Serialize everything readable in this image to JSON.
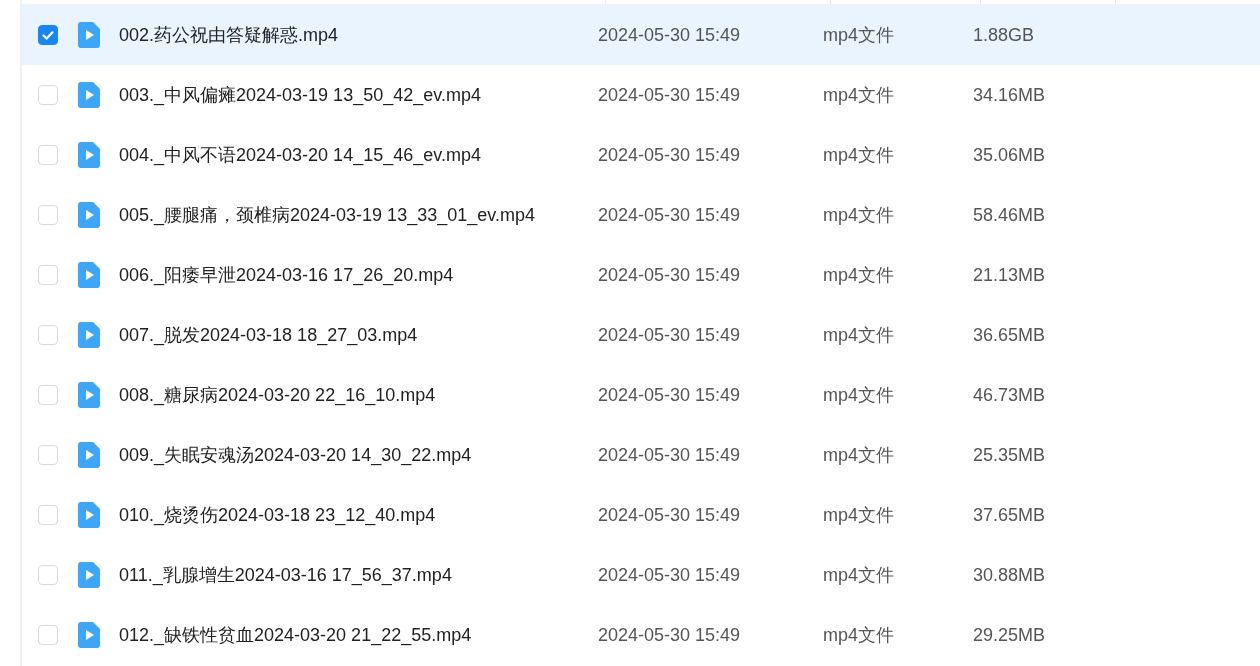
{
  "files": [
    {
      "name": "002.药公祝由答疑解惑.mp4",
      "modified": "2024-05-30 15:49",
      "type": "mp4文件",
      "size": "1.88GB",
      "selected": true
    },
    {
      "name": "003._中风偏瘫2024-03-19 13_50_42_ev.mp4",
      "modified": "2024-05-30 15:49",
      "type": "mp4文件",
      "size": "34.16MB",
      "selected": false
    },
    {
      "name": "004._中风不语2024-03-20 14_15_46_ev.mp4",
      "modified": "2024-05-30 15:49",
      "type": "mp4文件",
      "size": "35.06MB",
      "selected": false
    },
    {
      "name": "005._腰腿痛，颈椎病2024-03-19 13_33_01_ev.mp4",
      "modified": "2024-05-30 15:49",
      "type": "mp4文件",
      "size": "58.46MB",
      "selected": false
    },
    {
      "name": "006._阳痿早泄2024-03-16 17_26_20.mp4",
      "modified": "2024-05-30 15:49",
      "type": "mp4文件",
      "size": "21.13MB",
      "selected": false
    },
    {
      "name": "007._脱发2024-03-18 18_27_03.mp4",
      "modified": "2024-05-30 15:49",
      "type": "mp4文件",
      "size": "36.65MB",
      "selected": false
    },
    {
      "name": "008._糖尿病2024-03-20 22_16_10.mp4",
      "modified": "2024-05-30 15:49",
      "type": "mp4文件",
      "size": "46.73MB",
      "selected": false
    },
    {
      "name": "009._失眠安魂汤2024-03-20 14_30_22.mp4",
      "modified": "2024-05-30 15:49",
      "type": "mp4文件",
      "size": "25.35MB",
      "selected": false
    },
    {
      "name": "010._烧烫伤2024-03-18 23_12_40.mp4",
      "modified": "2024-05-30 15:49",
      "type": "mp4文件",
      "size": "37.65MB",
      "selected": false
    },
    {
      "name": "011._乳腺增生2024-03-16 17_56_37.mp4",
      "modified": "2024-05-30 15:49",
      "type": "mp4文件",
      "size": "30.88MB",
      "selected": false
    },
    {
      "name": "012._缺铁性贫血2024-03-20 21_22_55.mp4",
      "modified": "2024-05-30 15:49",
      "type": "mp4文件",
      "size": "29.25MB",
      "selected": false
    }
  ]
}
